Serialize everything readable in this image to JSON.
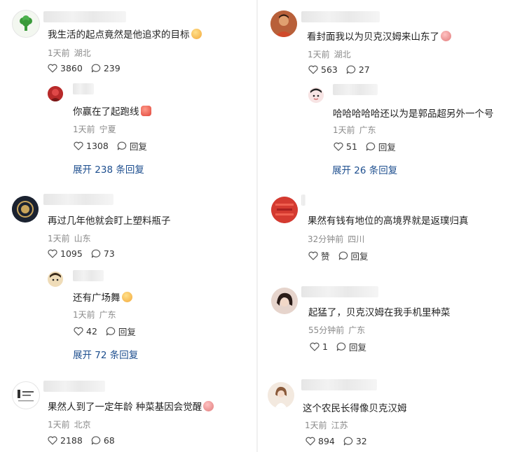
{
  "left": {
    "c1": {
      "text": "我生活的起点竟然是他追求的目标",
      "time": "1天前",
      "loc": "湖北",
      "likes": "3860",
      "replies": "239",
      "reply": {
        "text": "你赢在了起跑线",
        "time": "1天前",
        "loc": "宁夏",
        "likes": "1308",
        "reply_label": "回复"
      },
      "expand": "展开 238 条回复"
    },
    "c2": {
      "text": "再过几年他就会盯上塑料瓶子",
      "time": "1天前",
      "loc": "山东",
      "likes": "1095",
      "replies": "73",
      "reply": {
        "text": "还有广场舞",
        "time": "1天前",
        "loc": "广东",
        "likes": "42",
        "reply_label": "回复"
      },
      "expand": "展开 72 条回复"
    },
    "c3": {
      "text": "果然人到了一定年龄 种菜基因会觉醒",
      "time": "1天前",
      "loc": "北京",
      "likes": "2188",
      "replies": "68"
    }
  },
  "right": {
    "c1": {
      "text": "看封面我以为贝克汉姆来山东了",
      "time": "1天前",
      "loc": "湖北",
      "likes": "563",
      "replies": "27",
      "reply": {
        "text": "哈哈哈哈哈还以为是郭品超另外一个号",
        "time": "1天前",
        "loc": "广东",
        "likes": "51",
        "reply_label": "回复"
      },
      "expand": "展开 26 条回复"
    },
    "c2": {
      "text": "果然有钱有地位的高境界就是返璞归真",
      "time": "32分钟前",
      "loc": "四川",
      "likes": "赞",
      "reply_label": "回复"
    },
    "c3": {
      "text": "起猛了，贝克汉姆在我手机里种菜",
      "time": "55分钟前",
      "loc": "广东",
      "likes": "1",
      "reply_label": "回复"
    },
    "c4": {
      "text": "这个农民长得像贝克汉姆",
      "time": "1天前",
      "loc": "江苏",
      "likes": "894",
      "replies": "32"
    }
  },
  "icons": {
    "like": "heart-outline-icon",
    "comment": "speech-bubble-icon"
  },
  "colors": {
    "expand_link": "#1e4f8f",
    "meta": "#8a8a8a"
  }
}
